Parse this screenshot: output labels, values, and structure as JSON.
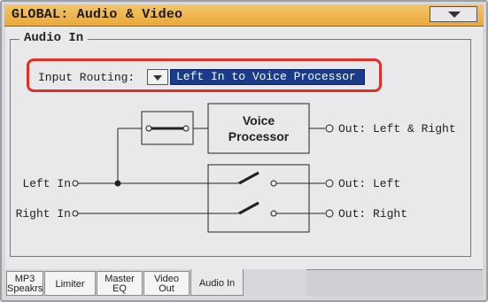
{
  "window": {
    "title": "GLOBAL: Audio & Video"
  },
  "group": {
    "label": "Audio In"
  },
  "input_routing": {
    "label": "Input Routing:",
    "value": "Left In to Voice Processor"
  },
  "diagram": {
    "voice_processor_line1": "Voice",
    "voice_processor_line2": "Processor",
    "left_in": "Left In",
    "right_in": "Right In",
    "out_left_right": "Out: Left & Right",
    "out_left": "Out: Left",
    "out_right": "Out: Right"
  },
  "tabs": [
    {
      "line1": "MP3",
      "line2": "Speakrs"
    },
    {
      "line1": "Limiter",
      "line2": ""
    },
    {
      "line1": "Master",
      "line2": "EQ"
    },
    {
      "line1": "Video",
      "line2": "Out"
    },
    {
      "line1": "Audio In",
      "line2": ""
    }
  ],
  "active_tab": "Audio In"
}
